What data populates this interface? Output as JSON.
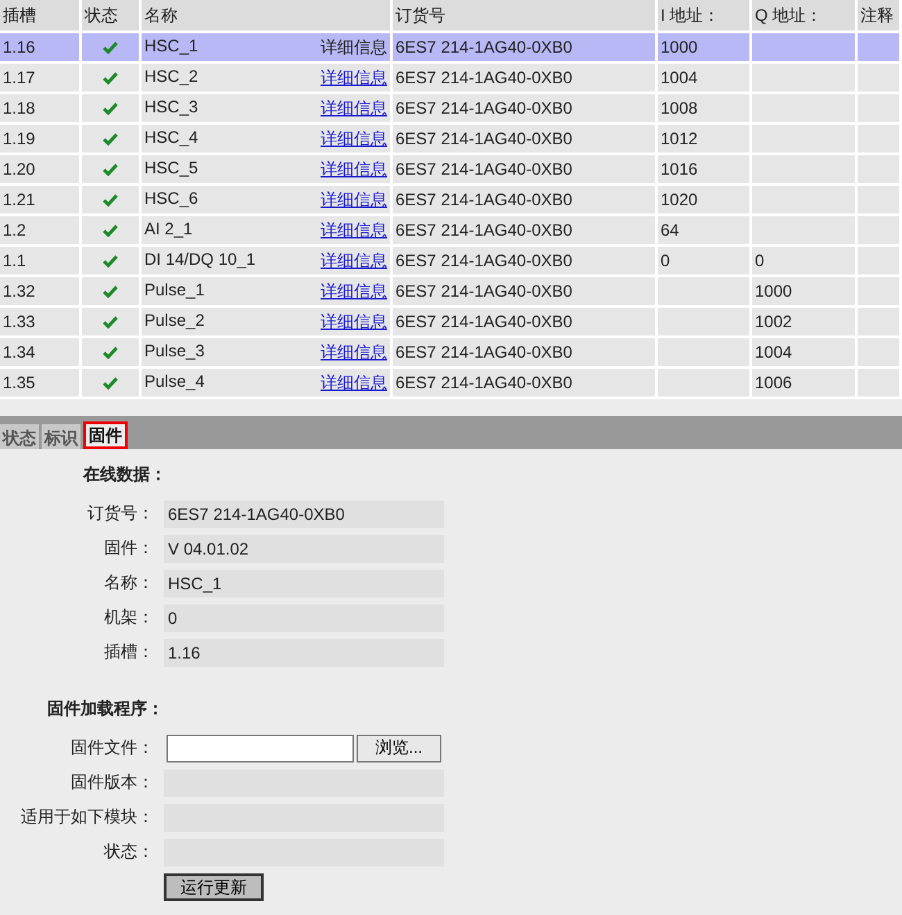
{
  "table": {
    "columns": [
      "插槽",
      "状态",
      "名称",
      "订货号",
      "I 地址：",
      "Q 地址：",
      "注释"
    ],
    "rows": [
      {
        "slot": "1.16",
        "ok": true,
        "name": "HSC_1",
        "link": "详细信息",
        "order": "6ES7 214-1AG40-0XB0",
        "i_addr": "1000",
        "q_addr": "",
        "selected": true
      },
      {
        "slot": "1.17",
        "ok": true,
        "name": "HSC_2",
        "link": "详细信息",
        "order": "6ES7 214-1AG40-0XB0",
        "i_addr": "1004",
        "q_addr": "",
        "selected": false
      },
      {
        "slot": "1.18",
        "ok": true,
        "name": "HSC_3",
        "link": "详细信息",
        "order": "6ES7 214-1AG40-0XB0",
        "i_addr": "1008",
        "q_addr": "",
        "selected": false
      },
      {
        "slot": "1.19",
        "ok": true,
        "name": "HSC_4",
        "link": "详细信息",
        "order": "6ES7 214-1AG40-0XB0",
        "i_addr": "1012",
        "q_addr": "",
        "selected": false
      },
      {
        "slot": "1.20",
        "ok": true,
        "name": "HSC_5",
        "link": "详细信息",
        "order": "6ES7 214-1AG40-0XB0",
        "i_addr": "1016",
        "q_addr": "",
        "selected": false
      },
      {
        "slot": "1.21",
        "ok": true,
        "name": "HSC_6",
        "link": "详细信息",
        "order": "6ES7 214-1AG40-0XB0",
        "i_addr": "1020",
        "q_addr": "",
        "selected": false
      },
      {
        "slot": "1.2",
        "ok": true,
        "name": "AI 2_1",
        "link": "详细信息",
        "order": "6ES7 214-1AG40-0XB0",
        "i_addr": "64",
        "q_addr": "",
        "selected": false
      },
      {
        "slot": "1.1",
        "ok": true,
        "name": "DI 14/DQ 10_1",
        "link": "详细信息",
        "order": "6ES7 214-1AG40-0XB0",
        "i_addr": "0",
        "q_addr": "0",
        "selected": false
      },
      {
        "slot": "1.32",
        "ok": true,
        "name": "Pulse_1",
        "link": "详细信息",
        "order": "6ES7 214-1AG40-0XB0",
        "i_addr": "",
        "q_addr": "1000",
        "selected": false
      },
      {
        "slot": "1.33",
        "ok": true,
        "name": "Pulse_2",
        "link": "详细信息",
        "order": "6ES7 214-1AG40-0XB0",
        "i_addr": "",
        "q_addr": "1002",
        "selected": false
      },
      {
        "slot": "1.34",
        "ok": true,
        "name": "Pulse_3",
        "link": "详细信息",
        "order": "6ES7 214-1AG40-0XB0",
        "i_addr": "",
        "q_addr": "1004",
        "selected": false
      },
      {
        "slot": "1.35",
        "ok": true,
        "name": "Pulse_4",
        "link": "详细信息",
        "order": "6ES7 214-1AG40-0XB0",
        "i_addr": "",
        "q_addr": "1006",
        "selected": false
      }
    ]
  },
  "tabs": [
    {
      "label": "状态",
      "selected": false
    },
    {
      "label": "标识",
      "selected": false
    },
    {
      "label": "固件",
      "selected": true
    }
  ],
  "online": {
    "heading": "在线数据：",
    "fields": [
      {
        "label": "订货号：",
        "value": "6ES7 214-1AG40-0XB0"
      },
      {
        "label": "固件：",
        "value": "V 04.01.02"
      },
      {
        "label": "名称：",
        "value": "HSC_1"
      },
      {
        "label": "机架：",
        "value": "0"
      },
      {
        "label": "插槽：",
        "value": "1.16"
      }
    ]
  },
  "loader": {
    "heading": "固件加载程序：",
    "fields": [
      {
        "label": "固件文件：",
        "kind": "file",
        "button": "浏览..."
      },
      {
        "label": "固件版本：",
        "kind": "readonly"
      },
      {
        "label": "适用于如下模块：",
        "kind": "readonly"
      },
      {
        "label": "状态：",
        "kind": "readonly"
      }
    ],
    "run_button": "运行更新"
  }
}
